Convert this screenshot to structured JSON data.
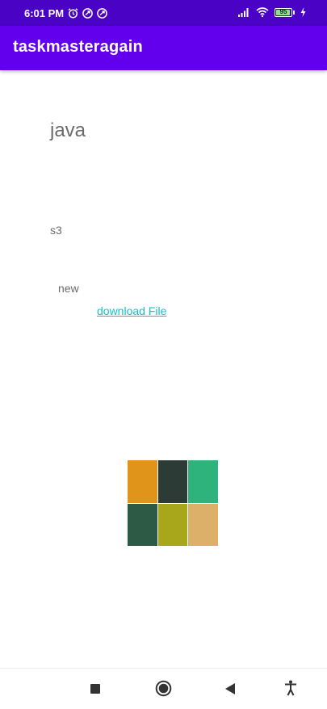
{
  "status_bar": {
    "time": "6:01 PM",
    "left_icons": [
      "alarm-icon",
      "sync-icon",
      "sync-icon"
    ],
    "right_icons": [
      "signal-icon",
      "wifi-icon",
      "battery-icon",
      "charging-icon"
    ],
    "battery_level": "95",
    "battery_fraction": 0.95
  },
  "app_bar": {
    "title": "taskmasteragain"
  },
  "task": {
    "title": "java",
    "body": "s3",
    "state": "new",
    "download_link": "download File",
    "image_icon": "paint-swatch-image"
  },
  "nav_bar": {
    "icons": [
      "recent-apps-icon",
      "home-icon",
      "back-icon",
      "accessibility-icon"
    ]
  },
  "colors": {
    "status_bar": "#4a03c4",
    "app_bar": "#6200ee",
    "text_gray": "#6b6b6b",
    "link": "#12c2c8",
    "swatches": [
      "#e0941a",
      "#2d3b36",
      "#2fb37c",
      "#2c5a45",
      "#a8a61a",
      "#ddb06a"
    ]
  }
}
